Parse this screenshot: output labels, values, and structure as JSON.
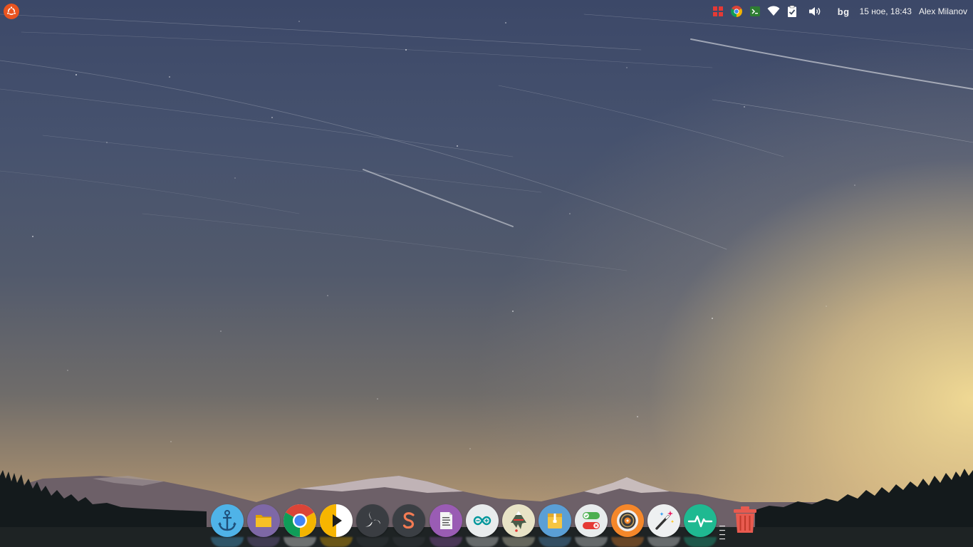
{
  "panel": {
    "launcher_icon": "ubuntu-logo-icon",
    "tray_icons": [
      "grid-apps-icon",
      "chrome-icon",
      "terminal-icon",
      "wifi-icon",
      "clipboard-check-icon",
      "volume-icon"
    ],
    "keyboard_layout": "bg",
    "clock": "15 ное, 18:43",
    "user": "Alex Milanov"
  },
  "dock": {
    "items": [
      "anchor-icon",
      "files-folder-icon",
      "chrome-icon",
      "media-player-icon",
      "obs-studio-icon",
      "sublime-text-icon",
      "text-editor-icon",
      "arduino-icon",
      "inkscape-icon",
      "archive-manager-icon",
      "settings-toggles-icon",
      "disks-icon",
      "magic-wand-icon",
      "system-monitor-icon"
    ],
    "trash_icon": "trash-icon"
  },
  "colors": {
    "ubuntu_orange": "#e95420",
    "panel_text": "#f2f2f2"
  }
}
